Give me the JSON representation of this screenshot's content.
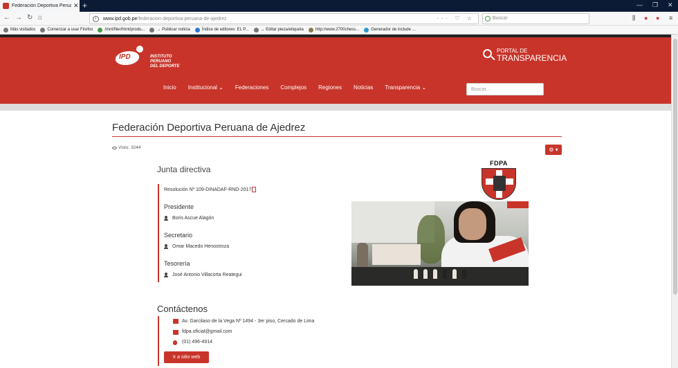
{
  "browser": {
    "tab_title": "Federación Deportiva Peruana",
    "url_domain": "www.ipd.gob.pe",
    "url_path": "/federacion-deportiva-peruana-de-ajedrez",
    "search_placeholder": "Buscar",
    "bookmarks": [
      "Más visitados",
      "Comenzar a usar Firefox",
      "/mnt/filer/html/produ...",
      "→ Publicar noticia",
      "Índice de editores: EL P...",
      "→ Editar pieza/etiqueta",
      "http://www.2700chess...",
      "Generador de include ..."
    ]
  },
  "header": {
    "logo_lines": [
      "INSTITUTO",
      "PERUANO",
      "DEL DEPORTE"
    ],
    "logo_mark": "IPD",
    "transparency_small": "PORTAL DE",
    "transparency_big": "TRANSPARENCIA",
    "nav": [
      "Inicio",
      "Institucional ⌄",
      "Federaciones",
      "Complejos",
      "Regiones",
      "Noticias",
      "Transparencia ⌄"
    ],
    "search_placeholder": "Buscar..."
  },
  "article": {
    "title": "Federación Deportiva Peruana de Ajedrez",
    "views": "Visto: 3244",
    "tools_label": "⚙ ▾"
  },
  "junta": {
    "heading": "Junta directiva",
    "resolution": "Resolución Nº 109-DINADAF-RND-2017",
    "roles": [
      {
        "title": "Presidente",
        "name": "Boris Ascue Alagón"
      },
      {
        "title": "Secretario",
        "name": "Omar Macedo Henostroza"
      },
      {
        "title": "Tesorería",
        "name": "José Antonio Villacorta Reategui"
      }
    ]
  },
  "fdpa_logo_text": "FDPA",
  "contact": {
    "heading": "Contáctenos",
    "address": "Av. Garcilaso de la Vega Nº 1494 - 3er piso, Cercado de Lima",
    "email": "fdpa.oficial@gmail.com",
    "phone": "(01) 496-4914",
    "button": "Ir a sitio web"
  },
  "colors": {
    "accent": "#c8342a",
    "header_bg": "#c8342a"
  }
}
